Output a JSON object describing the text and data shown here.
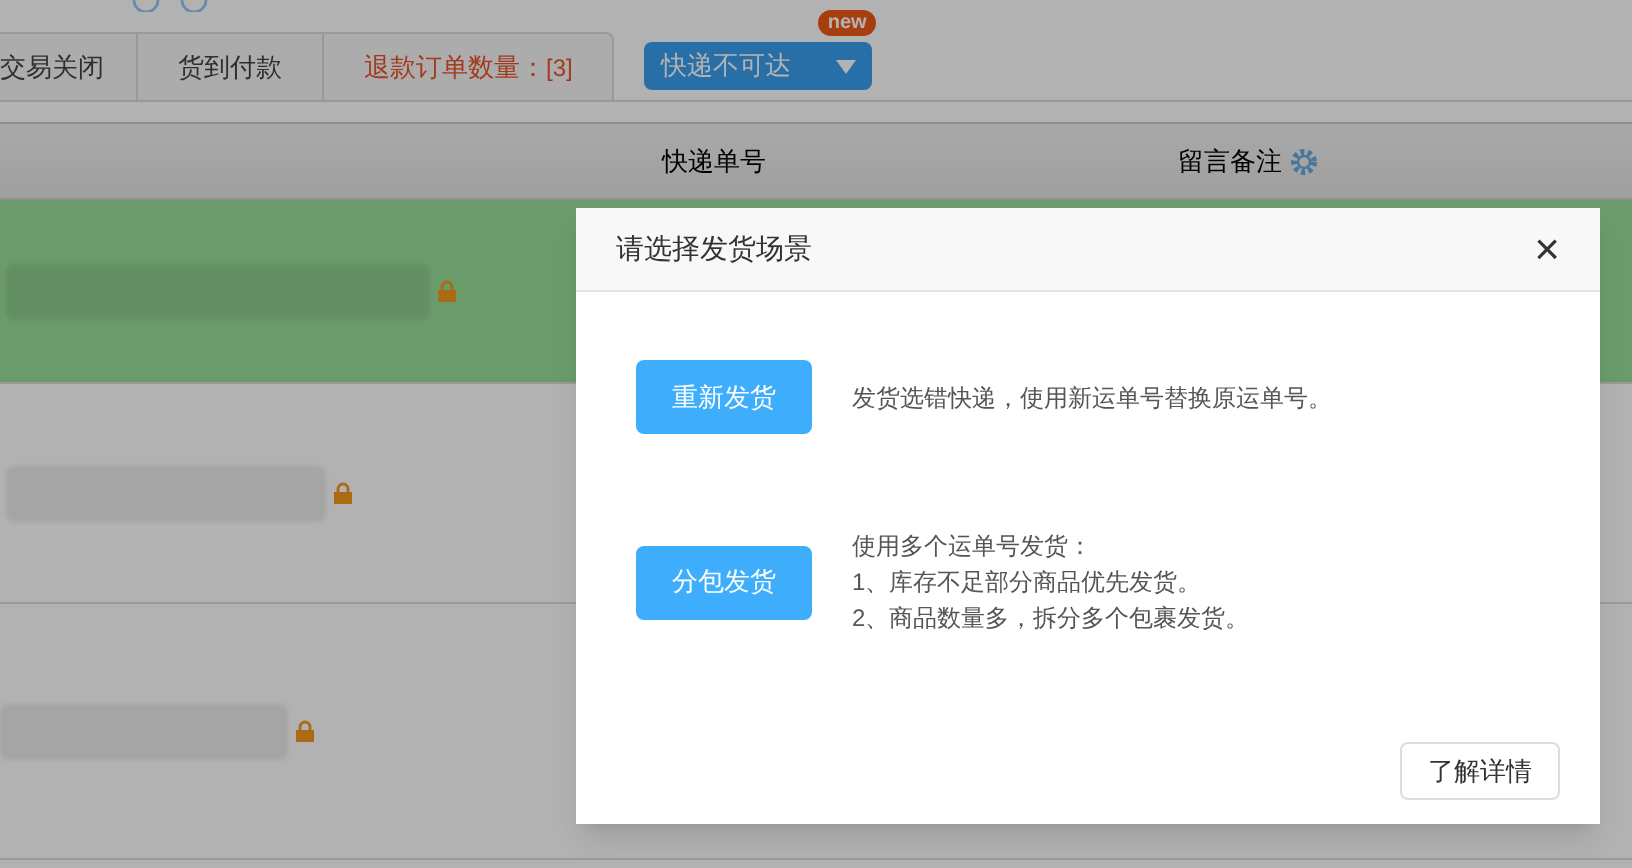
{
  "tabs": [
    {
      "kind": "plain",
      "label": "交易关闭"
    },
    {
      "kind": "plain",
      "label": "货到付款"
    },
    {
      "kind": "count",
      "label": "退款订单数量：",
      "count": "[3]"
    }
  ],
  "dropdown": {
    "value": "快递不可达",
    "badge": "new"
  },
  "columns": [
    "快递单号",
    "留言备注"
  ],
  "rows": [
    {
      "selected": true
    },
    {
      "selected": false
    },
    {
      "selected": false
    }
  ],
  "modal": {
    "title": "请选择发货场景",
    "close": "×",
    "options": [
      {
        "button": "重新发货",
        "lines": [
          "发货选错快递，使用新运单号替换原运单号。"
        ]
      },
      {
        "button": "分包发货",
        "lines": [
          "使用多个运单号发货：",
          "1、库存不足部分商品优先发货。",
          "2、商品数量多，拆分多个包裹发货。"
        ]
      }
    ],
    "footer_button": "了解详情"
  }
}
